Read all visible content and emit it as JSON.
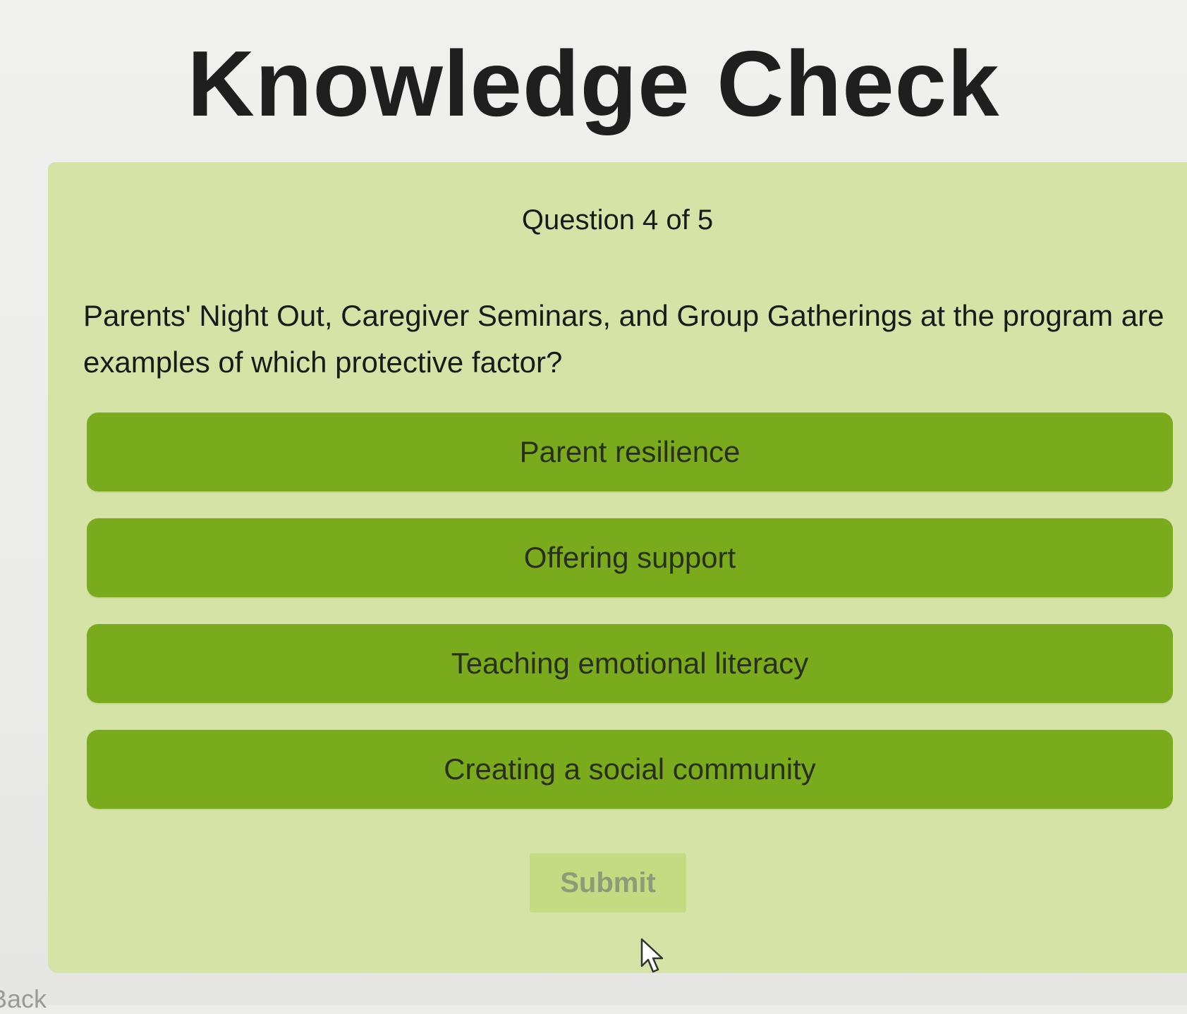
{
  "header": {
    "title": "Knowledge Check"
  },
  "quiz": {
    "counter": "Question 4 of 5",
    "question": "Parents' Night Out, Caregiver Seminars, and Group Gatherings at the program are examples of which protective factor?",
    "options": [
      {
        "label": "Parent resilience"
      },
      {
        "label": "Offering support"
      },
      {
        "label": "Teaching emotional literacy"
      },
      {
        "label": "Creating a social community"
      }
    ],
    "submit_label": "Submit"
  },
  "footer": {
    "back_label": "Back"
  },
  "colors": {
    "panel_background": "#d5e3a6",
    "option_green": "#7aab1c",
    "submit_disabled": "#c4db82"
  },
  "icons": {
    "cursor": "mouse-pointer-icon"
  }
}
